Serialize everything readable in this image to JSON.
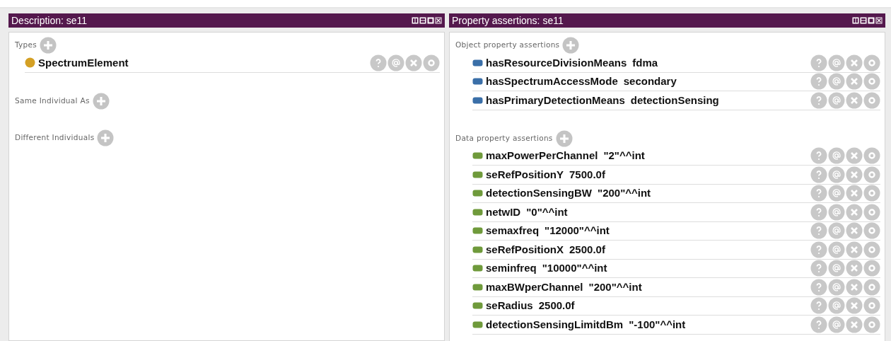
{
  "panels": [
    {
      "title": "Description: se11",
      "sections": [
        {
          "label": "Types",
          "items": [
            {
              "kind": "class",
              "name": "SpectrumElement"
            }
          ]
        },
        {
          "label": "Same Individual As"
        },
        {
          "label": "Different Individuals"
        }
      ]
    },
    {
      "title": "Property assertions: se11",
      "sections": [
        {
          "label": "Object property assertions",
          "items": [
            {
              "kind": "object",
              "name": "hasResourceDivisionMeans",
              "value": "fdma"
            },
            {
              "kind": "object",
              "name": "hasSpectrumAccessMode",
              "value": "secondary"
            },
            {
              "kind": "object",
              "name": "hasPrimaryDetectionMeans",
              "value": "detectionSensing"
            }
          ]
        },
        {
          "label": "Data property assertions",
          "items": [
            {
              "kind": "data",
              "name": "maxPowerPerChannel",
              "value": "\"2\"^^int"
            },
            {
              "kind": "data",
              "name": "seRefPositionY",
              "value": "7500.0f"
            },
            {
              "kind": "data",
              "name": "detectionSensingBW",
              "value": "\"200\"^^int"
            },
            {
              "kind": "data",
              "name": "netwID",
              "value": "\"0\"^^int"
            },
            {
              "kind": "data",
              "name": "semaxfreq",
              "value": "\"12000\"^^int"
            },
            {
              "kind": "data",
              "name": "seRefPositionX",
              "value": "2500.0f"
            },
            {
              "kind": "data",
              "name": "seminfreq",
              "value": "\"10000\"^^int"
            },
            {
              "kind": "data",
              "name": "maxBWperChannel",
              "value": "\"200\"^^int"
            },
            {
              "kind": "data",
              "name": "seRadius",
              "value": "2500.0f"
            },
            {
              "kind": "data",
              "name": "detectionSensingLimitdBm",
              "value": "\"-100\"^^int"
            }
          ]
        }
      ]
    }
  ]
}
